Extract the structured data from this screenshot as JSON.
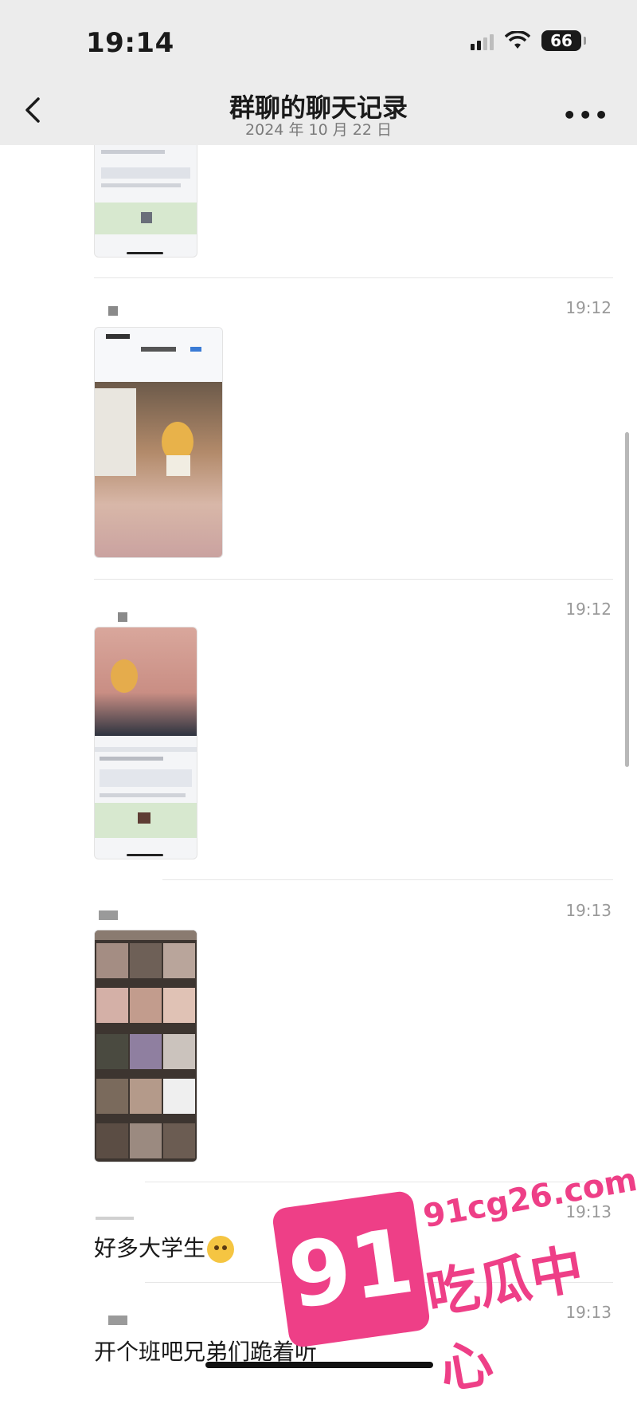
{
  "status_bar": {
    "time": "19:14",
    "battery": "66"
  },
  "header": {
    "title": "群聊的聊天记录",
    "subtitle": "2024 年 10 月 22 日"
  },
  "icons": {
    "back": "chevron-left-icon",
    "more": "more-icon"
  },
  "messages": [
    {
      "time": "19:12"
    },
    {
      "time": "19:12"
    },
    {
      "time": "19:13"
    },
    {
      "time": "19:13",
      "text": "好多大学生"
    },
    {
      "time": "19:13",
      "text": "开个班吧兄弟们跪着听"
    }
  ],
  "watermark": {
    "number": "91",
    "url": "91cg26.com",
    "name": "吃瓜中心"
  },
  "colors": {
    "accent_pink": "#ee3f87",
    "header_bg": "#ececec"
  }
}
